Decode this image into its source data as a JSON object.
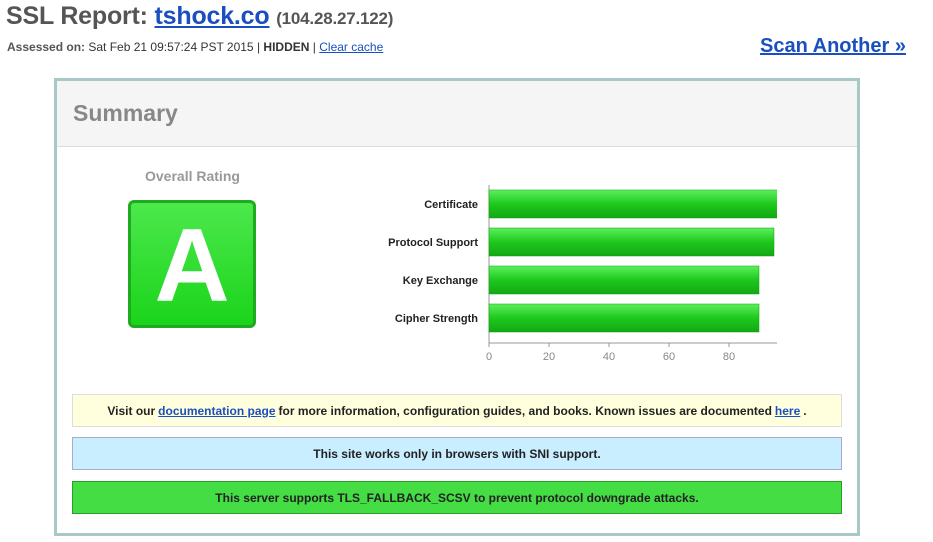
{
  "header": {
    "title_prefix": "SSL Report:",
    "host": "tshock.co",
    "ip": "(104.28.27.122)"
  },
  "assessment": {
    "label": "Assessed on:",
    "date": "Sat Feb 21 09:57:24 PST 2015",
    "separator": "|",
    "visibility": "HIDDEN",
    "clear_cache": "Clear cache"
  },
  "scan_another": "Scan Another »",
  "summary": {
    "title": "Summary",
    "overall_label": "Overall Rating",
    "grade": "A"
  },
  "colors": {
    "bar_green": "#1ec81e",
    "score_green": "#22b022",
    "link_blue": "#1a4fbf"
  },
  "chart_data": {
    "type": "bar",
    "orientation": "horizontal",
    "categories": [
      "Certificate",
      "Protocol Support",
      "Key Exchange",
      "Cipher Strength"
    ],
    "values": [
      100,
      95,
      90,
      90
    ],
    "xlim": [
      0,
      100
    ],
    "xticks": [
      0,
      20,
      40,
      60,
      80,
      100
    ],
    "grid": false
  },
  "notices": {
    "doc_prefix": "Visit our",
    "doc_link": "documentation page",
    "doc_middle": "for more information, configuration guides, and books. Known issues are documented",
    "doc_here": "here",
    "doc_suffix": ".",
    "sni": "This site works only in browsers with SNI support.",
    "fallback": "This server supports TLS_FALLBACK_SCSV to prevent protocol downgrade attacks."
  }
}
